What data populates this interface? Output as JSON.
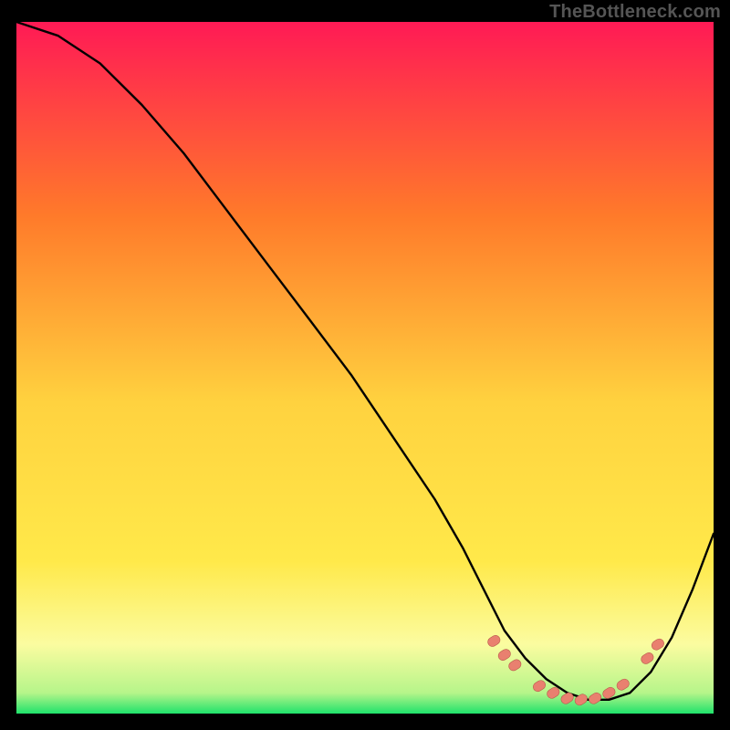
{
  "watermark": "TheBottleneck.com",
  "colors": {
    "bg": "#000000",
    "curve": "#000000",
    "marker_fill": "#e9806f",
    "marker_stroke": "#b85a4b",
    "gradient_top": "#ff1a55",
    "gradient_mid1": "#ff7a2a",
    "gradient_mid2": "#ffe94a",
    "gradient_pale": "#fbfca0",
    "gradient_bottom": "#1fe26b"
  },
  "chart_data": {
    "type": "line",
    "title": "",
    "xlabel": "",
    "ylabel": "",
    "xlim": [
      0,
      100
    ],
    "ylim": [
      0,
      100
    ],
    "grid": false,
    "legend": false,
    "series": [
      {
        "name": "bottleneck-curve",
        "x": [
          0,
          6,
          12,
          18,
          24,
          30,
          36,
          42,
          48,
          54,
          60,
          64,
          67,
          70,
          73,
          76,
          79,
          82,
          85,
          88,
          91,
          94,
          97,
          100
        ],
        "values": [
          100,
          98,
          94,
          88,
          81,
          73,
          65,
          57,
          49,
          40,
          31,
          24,
          18,
          12,
          8,
          5,
          3,
          2,
          2,
          3,
          6,
          11,
          18,
          26
        ]
      }
    ],
    "markers": {
      "name": "highlight-segments",
      "points": [
        {
          "x": 68.5,
          "y": 10.5
        },
        {
          "x": 70.0,
          "y": 8.5
        },
        {
          "x": 71.5,
          "y": 7.0
        },
        {
          "x": 75.0,
          "y": 4.0
        },
        {
          "x": 77.0,
          "y": 3.0
        },
        {
          "x": 79.0,
          "y": 2.2
        },
        {
          "x": 81.0,
          "y": 2.0
        },
        {
          "x": 83.0,
          "y": 2.2
        },
        {
          "x": 85.0,
          "y": 3.0
        },
        {
          "x": 87.0,
          "y": 4.2
        },
        {
          "x": 90.5,
          "y": 8.0
        },
        {
          "x": 92.0,
          "y": 10.0
        }
      ]
    }
  }
}
